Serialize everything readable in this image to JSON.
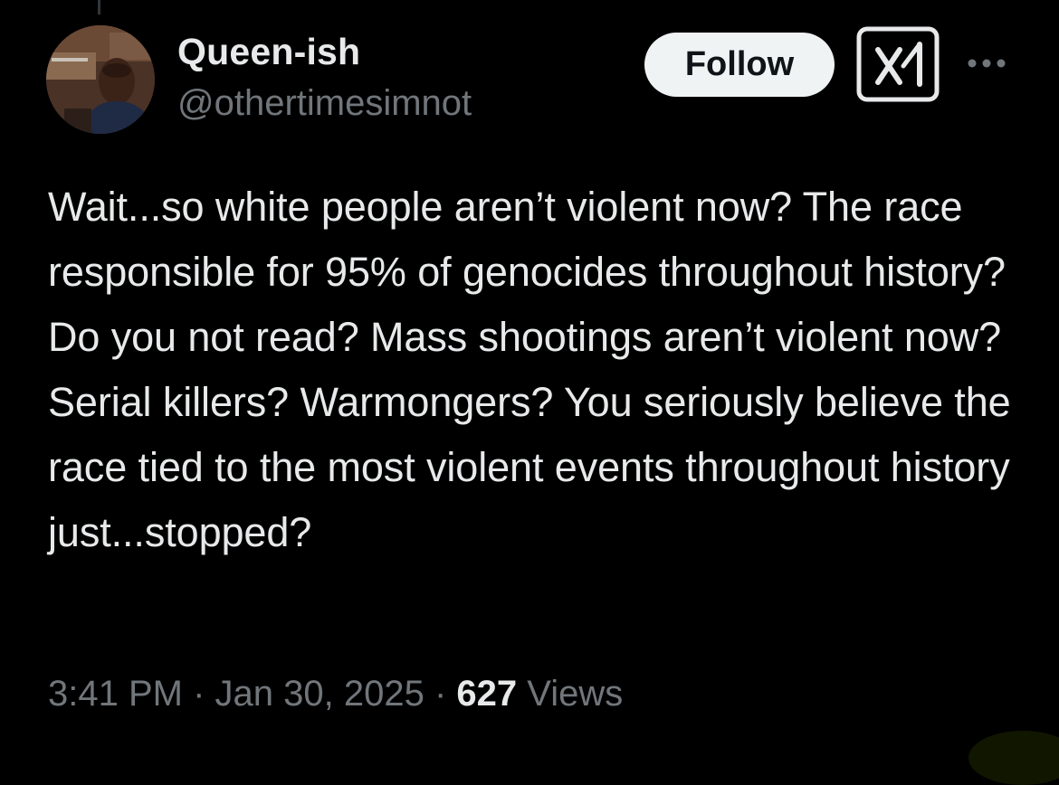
{
  "author": {
    "display_name": "Queen-ish",
    "handle": "@othertimesimnot"
  },
  "actions": {
    "follow_label": "Follow",
    "grok_icon": "grok-logo-icon",
    "more_icon": "more-horizontal-icon"
  },
  "tweet": {
    "text": "Wait...so white people aren’t violent now? The race responsible for 95% of genocides throughout history? Do you not read? Mass shootings aren’t violent now? Serial killers? Warmongers? You seriously believe the race tied to the most violent events throughout history just...stopped?"
  },
  "meta": {
    "time": "3:41 PM",
    "separator": " · ",
    "date": "Jan 30, 2025",
    "views_count": "627",
    "views_label": "Views"
  },
  "colors": {
    "background": "#000000",
    "text_primary": "#e7e9ea",
    "text_secondary": "#71767b",
    "follow_bg": "#eff3f4"
  }
}
